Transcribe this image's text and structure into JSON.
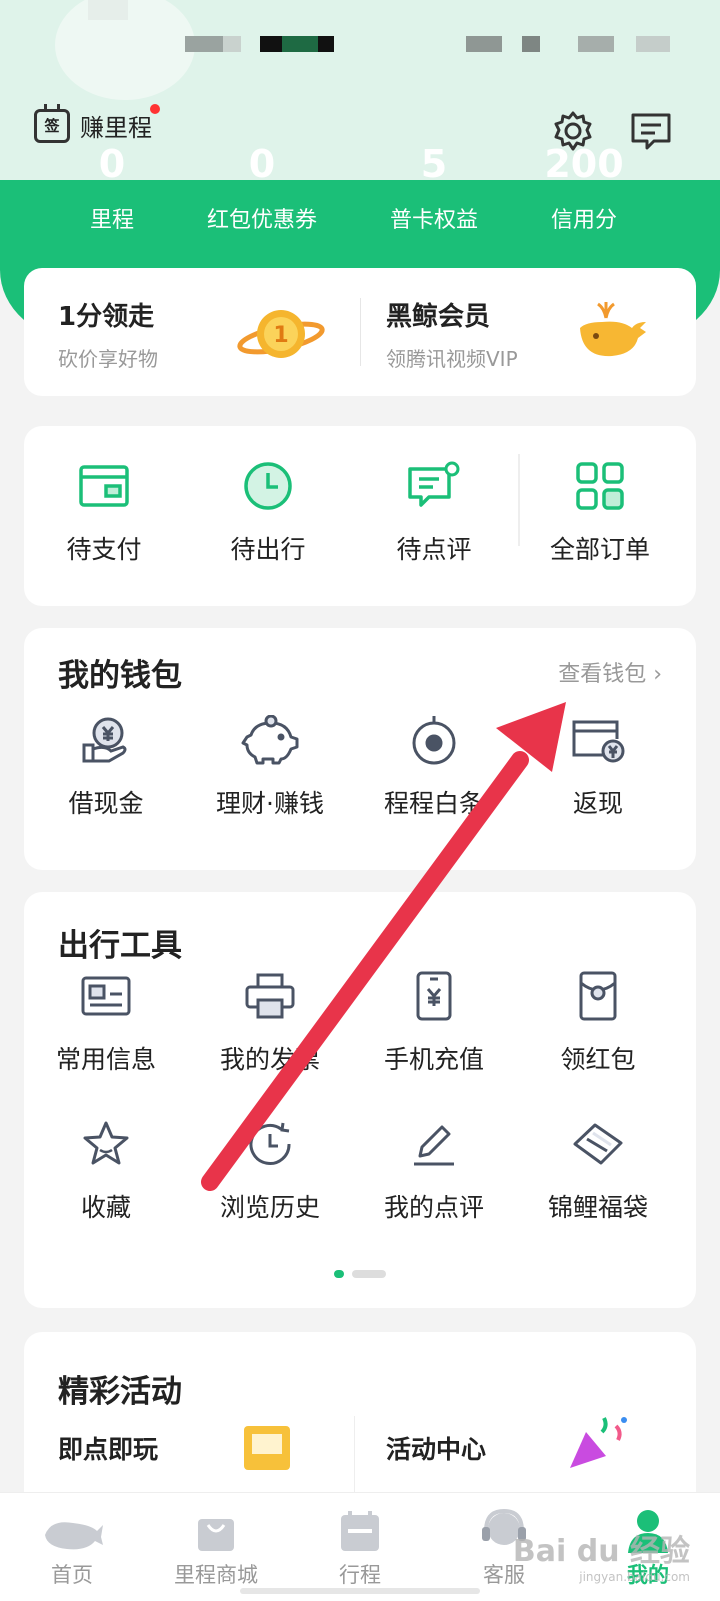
{
  "header": {
    "checkin_icon_char": "签",
    "checkin_label": "赚里程"
  },
  "stats": [
    {
      "value": "0",
      "label": "里程"
    },
    {
      "value": "0",
      "label": "红包优惠券"
    },
    {
      "value": "5",
      "label": "普卡权益"
    },
    {
      "value": "200",
      "label": "信用分"
    }
  ],
  "promo": {
    "left": {
      "title": "1分领走",
      "subtitle": "砍价享好物"
    },
    "right": {
      "title": "黑鲸会员",
      "subtitle": "领腾讯视频VIP"
    }
  },
  "orders": [
    {
      "label": "待支付",
      "icon": "wallet-icon"
    },
    {
      "label": "待出行",
      "icon": "clock-icon"
    },
    {
      "label": "待点评",
      "icon": "comment-icon"
    },
    {
      "label": "全部订单",
      "icon": "grid-icon"
    }
  ],
  "wallet": {
    "title": "我的钱包",
    "more": "查看钱包 ›",
    "items": [
      {
        "label": "借现金",
        "icon": "cash-hand-icon"
      },
      {
        "label": "理财·赚钱",
        "icon": "piggy-bank-icon"
      },
      {
        "label": "程程白条",
        "icon": "target-icon"
      },
      {
        "label": "返现",
        "icon": "card-yen-icon"
      }
    ]
  },
  "tools": {
    "title": "出行工具",
    "items": [
      {
        "label": "常用信息",
        "icon": "id-card-icon"
      },
      {
        "label": "我的发票",
        "icon": "printer-icon"
      },
      {
        "label": "手机充值",
        "icon": "phone-yen-icon"
      },
      {
        "label": "领红包",
        "icon": "red-envelope-icon"
      },
      {
        "label": "收藏",
        "icon": "star-icon"
      },
      {
        "label": "浏览历史",
        "icon": "history-icon"
      },
      {
        "label": "我的点评",
        "icon": "pencil-icon"
      },
      {
        "label": "锦鲤福袋",
        "icon": "tag-icon"
      }
    ]
  },
  "events": {
    "title": "精彩活动",
    "left": "即点即玩",
    "right": "活动中心"
  },
  "tabbar": [
    {
      "label": "首页",
      "icon": "whale-icon"
    },
    {
      "label": "里程商城",
      "icon": "shopping-bag-icon"
    },
    {
      "label": "行程",
      "icon": "calendar-icon"
    },
    {
      "label": "客服",
      "icon": "headset-icon"
    },
    {
      "label": "我的",
      "icon": "person-icon",
      "active": true
    }
  ],
  "colors": {
    "brand": "#1bbf78",
    "annotation_arrow": "#e8344a"
  },
  "watermark": {
    "text": "Bai du 经验",
    "sub": "jingyan.baidu.com"
  }
}
